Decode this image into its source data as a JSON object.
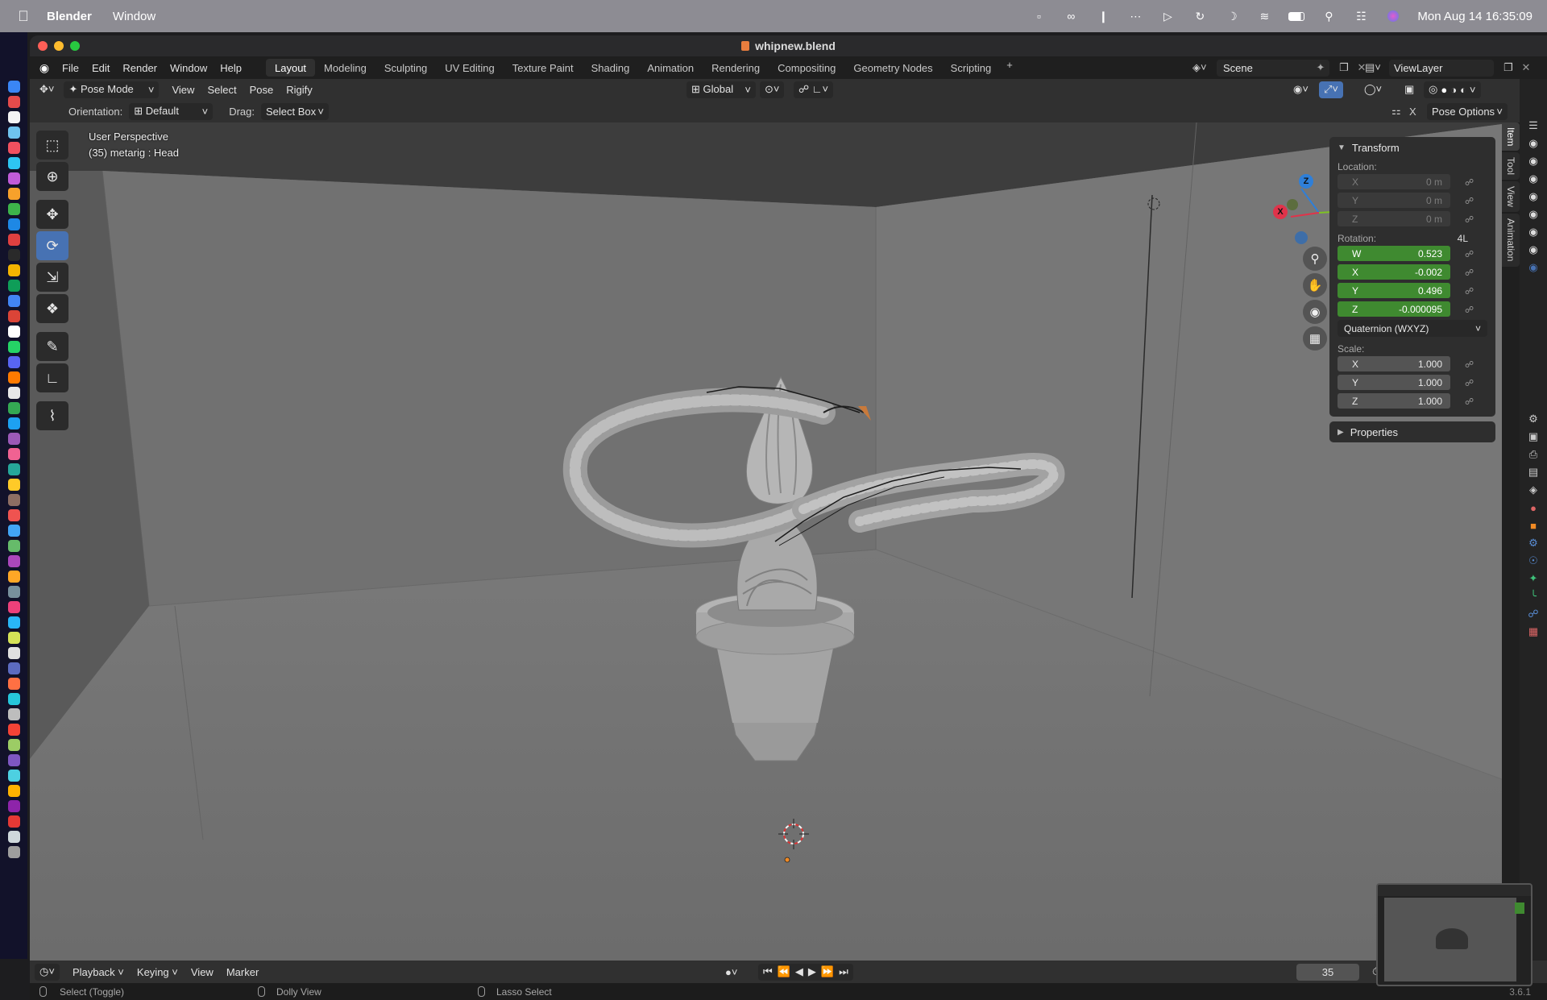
{
  "mac_menubar": {
    "app_name": "Blender",
    "menus": [
      "Window"
    ],
    "clock": "Mon Aug 14  16:35:09"
  },
  "window": {
    "title": "whipnew.blend"
  },
  "top_menu": {
    "items": [
      "File",
      "Edit",
      "Render",
      "Window",
      "Help"
    ],
    "workspaces": [
      "Layout",
      "Modeling",
      "Sculpting",
      "UV Editing",
      "Texture Paint",
      "Shading",
      "Animation",
      "Rendering",
      "Compositing",
      "Geometry Nodes",
      "Scripting"
    ],
    "active_workspace": "Layout",
    "scene_name": "Scene",
    "view_layer": "ViewLayer"
  },
  "viewport_header": {
    "mode": "Pose Mode",
    "menus": [
      "View",
      "Select",
      "Pose",
      "Rigify"
    ],
    "transform_orientation": "Global"
  },
  "tool_header": {
    "orientation_label": "Orientation:",
    "orientation_value": "Default",
    "drag_label": "Drag:",
    "drag_value": "Select Box",
    "axis_x": "X",
    "pose_options": "Pose Options"
  },
  "viewport": {
    "perspective_label": "User Perspective",
    "object_label": "(35) metarig : Head",
    "gizmo_axes": {
      "x": "X",
      "y": "Y",
      "z": "Z"
    }
  },
  "n_panel": {
    "transform_title": "Transform",
    "location_label": "Location:",
    "location": [
      {
        "axis": "X",
        "value": "0 m"
      },
      {
        "axis": "Y",
        "value": "0 m"
      },
      {
        "axis": "Z",
        "value": "0 m"
      }
    ],
    "rotation_label": "Rotation:",
    "rotation_lock_tag": "4L",
    "rotation": [
      {
        "axis": "W",
        "value": "0.523"
      },
      {
        "axis": "X",
        "value": "-0.002"
      },
      {
        "axis": "Y",
        "value": "0.496"
      },
      {
        "axis": "Z",
        "value": "-0.000095"
      }
    ],
    "rotation_mode": "Quaternion (WXYZ)",
    "scale_label": "Scale:",
    "scale": [
      {
        "axis": "X",
        "value": "1.000"
      },
      {
        "axis": "Y",
        "value": "1.000"
      },
      {
        "axis": "Z",
        "value": "1.000"
      }
    ],
    "properties_title": "Properties"
  },
  "side_tabs": [
    "Item",
    "Tool",
    "View",
    "Animation"
  ],
  "timeline": {
    "menus": [
      "Playback",
      "Keying",
      "View",
      "Marker"
    ],
    "current_frame": "35"
  },
  "status_bar": {
    "left": "Select (Toggle)",
    "middle": "Dolly View",
    "right": "Lasso Select",
    "version": "3.6.1"
  },
  "colors": {
    "accent_blue": "#4772b3",
    "keyed_green": "#3f8a30",
    "axis_x": "#e0334a",
    "axis_y": "#7ec322",
    "axis_z": "#2f7fd8"
  }
}
